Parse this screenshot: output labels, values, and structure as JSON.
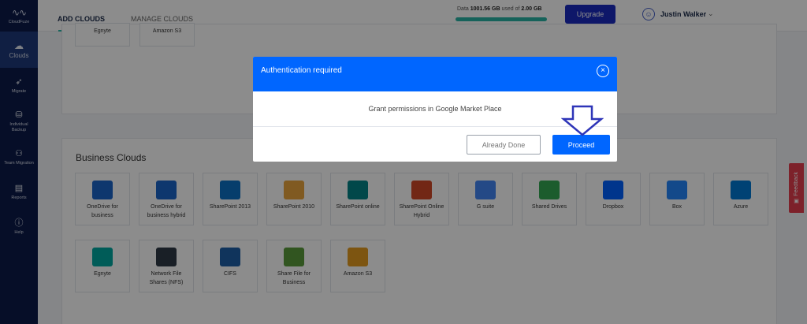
{
  "sidebar": {
    "logo": "CloudFuze",
    "items": [
      {
        "label": "Clouds",
        "icon": "cloud-icon"
      },
      {
        "label": "Migrate",
        "icon": "rocket-icon"
      },
      {
        "label": "Individual Backup",
        "icon": "database-icon"
      },
      {
        "label": "Team Migration",
        "icon": "users-icon"
      },
      {
        "label": "Reports",
        "icon": "report-icon"
      },
      {
        "label": "Help",
        "icon": "help-icon"
      }
    ]
  },
  "header": {
    "tabs": [
      "ADD CLOUDS",
      "MANAGE CLOUDS"
    ],
    "storage": {
      "prefix": "Data",
      "used": "1001.56 GB",
      "middle": "used of",
      "total": "2.00 GB",
      "fill_percent": 100
    },
    "upgrade_label": "Upgrade",
    "user_name": "Justin Walker"
  },
  "top_partial_tiles": [
    "Egnyte",
    "Amazon S3"
  ],
  "business": {
    "title": "Business Clouds",
    "row1": [
      {
        "label": "OneDrive for business",
        "icon": "onedrive-icon",
        "color": "#1b64c8"
      },
      {
        "label": "OneDrive for business hybrid",
        "icon": "onedrive-hybrid-icon",
        "color": "#1b64c8"
      },
      {
        "label": "SharePoint 2013",
        "icon": "sharepoint-icon",
        "color": "#0b72c5"
      },
      {
        "label": "SharePoint 2010",
        "icon": "sharepoint-2010-icon",
        "color": "#e9a53d"
      },
      {
        "label": "SharePoint online",
        "icon": "sharepoint-online-icon",
        "color": "#038387"
      },
      {
        "label": "SharePoint Online Hybrid",
        "icon": "sharepoint-hybrid-icon",
        "color": "#d04727"
      },
      {
        "label": "G suite",
        "icon": "gsuite-icon",
        "color": "#4285f4"
      },
      {
        "label": "Shared Drives",
        "icon": "google-drive-icon",
        "color": "#34a853"
      },
      {
        "label": "Dropbox",
        "icon": "dropbox-icon",
        "color": "#0061ff"
      },
      {
        "label": "Box",
        "icon": "box-icon",
        "color": "#2486fc"
      },
      {
        "label": "Azure",
        "icon": "azure-icon",
        "color": "#0078d4"
      }
    ],
    "row2": [
      {
        "label": "Egnyte",
        "icon": "egnyte-icon",
        "color": "#00a8a0"
      },
      {
        "label": "Network File Shares (NFS)",
        "icon": "nfs-icon",
        "color": "#2f3a45"
      },
      {
        "label": "CIFS",
        "icon": "cifs-icon",
        "color": "#1e5fa8"
      },
      {
        "label": "Share File for Business",
        "icon": "sharefile-icon",
        "color": "#5a9b3b"
      },
      {
        "label": "Amazon S3",
        "icon": "amazon-s3-icon",
        "color": "#e39b20"
      }
    ]
  },
  "feedback_label": "Feedback",
  "modal": {
    "title": "Authentication required",
    "message": "Grant permissions in Google Market Place",
    "already_done_label": "Already Done",
    "proceed_label": "Proceed"
  }
}
